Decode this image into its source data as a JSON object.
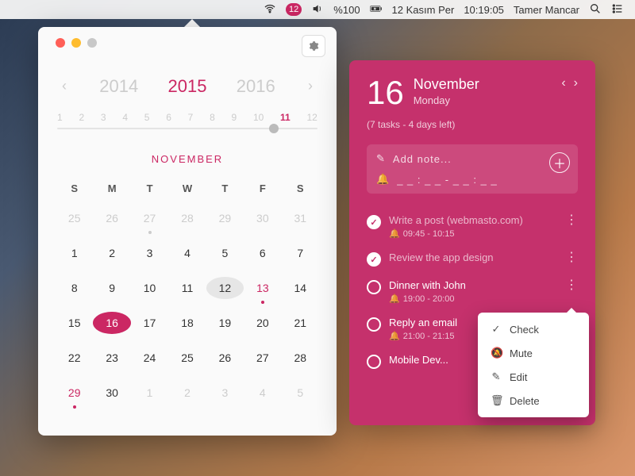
{
  "menubar": {
    "badge": "12",
    "battery": "%100",
    "date": "12 Kasım Per",
    "time": "10:19:05",
    "user": "Tamer Mancar"
  },
  "calendar": {
    "years": {
      "prev": "2014",
      "current": "2015",
      "next": "2016"
    },
    "months": [
      "1",
      "2",
      "3",
      "4",
      "5",
      "6",
      "7",
      "8",
      "9",
      "10",
      "11",
      "12"
    ],
    "active_month_index": 10,
    "month_label": "NOVEMBER",
    "dow": [
      "S",
      "M",
      "T",
      "W",
      "T",
      "F",
      "S"
    ],
    "weeks": [
      [
        {
          "n": "25",
          "cls": "other"
        },
        {
          "n": "26",
          "cls": "other"
        },
        {
          "n": "27",
          "cls": "other",
          "dot": "grey"
        },
        {
          "n": "28",
          "cls": "other"
        },
        {
          "n": "29",
          "cls": "other"
        },
        {
          "n": "30",
          "cls": "other"
        },
        {
          "n": "31",
          "cls": "other"
        }
      ],
      [
        {
          "n": "1"
        },
        {
          "n": "2"
        },
        {
          "n": "3"
        },
        {
          "n": "4"
        },
        {
          "n": "5"
        },
        {
          "n": "6"
        },
        {
          "n": "7"
        }
      ],
      [
        {
          "n": "8"
        },
        {
          "n": "9"
        },
        {
          "n": "10"
        },
        {
          "n": "11"
        },
        {
          "n": "12",
          "cls": "today"
        },
        {
          "n": "13",
          "cls": "sunred",
          "dot": "pink"
        },
        {
          "n": "14"
        }
      ],
      [
        {
          "n": "15"
        },
        {
          "n": "16",
          "cls": "sel"
        },
        {
          "n": "17"
        },
        {
          "n": "18"
        },
        {
          "n": "19"
        },
        {
          "n": "20"
        },
        {
          "n": "21"
        }
      ],
      [
        {
          "n": "22"
        },
        {
          "n": "23"
        },
        {
          "n": "24"
        },
        {
          "n": "25"
        },
        {
          "n": "26"
        },
        {
          "n": "27"
        },
        {
          "n": "28"
        }
      ],
      [
        {
          "n": "29",
          "cls": "sunred",
          "dot": "pink"
        },
        {
          "n": "30"
        },
        {
          "n": "1",
          "cls": "other"
        },
        {
          "n": "2",
          "cls": "other"
        },
        {
          "n": "3",
          "cls": "other"
        },
        {
          "n": "4",
          "cls": "other"
        },
        {
          "n": "5",
          "cls": "other"
        }
      ]
    ]
  },
  "tasks_panel": {
    "day": "16",
    "month": "November",
    "weekday": "Monday",
    "subtitle": "(7 tasks - 4 days left)",
    "add_note_placeholder": "Add note...",
    "add_time_placeholder": "_ _ : _ _  -  _ _ : _ _",
    "items": [
      {
        "title": "Write a post  (webmasto.com)",
        "time": "09:45 - 10:15",
        "done": true,
        "alarm": true
      },
      {
        "title": "Review the app design",
        "time": "",
        "done": true,
        "alarm": false
      },
      {
        "title": "Dinner with John",
        "time": "19:00 - 20:00",
        "done": false,
        "alarm": true
      },
      {
        "title": "Reply an email",
        "time": "21:00 - 21:15",
        "done": false,
        "alarm": true
      },
      {
        "title": "Mobile Dev...",
        "time": "",
        "done": false,
        "alarm": false
      }
    ]
  },
  "context_menu": {
    "items": [
      {
        "icon": "check",
        "label": "Check"
      },
      {
        "icon": "mute",
        "label": "Mute"
      },
      {
        "icon": "edit",
        "label": "Edit"
      },
      {
        "icon": "delete",
        "label": "Delete"
      }
    ]
  }
}
